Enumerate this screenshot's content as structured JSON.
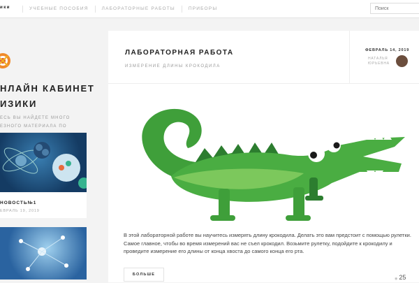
{
  "topbar": {
    "home": "ики",
    "nav": [
      "УЧЕБНЫЕ ПОСОБИЯ",
      "ЛАБОРАТОРНЫЕ РАБОТЫ",
      "ПРИБОРЫ"
    ],
    "search_placeholder": "Поиск"
  },
  "sidebar": {
    "title_line1": "НЛАЙН КАБИНЕТ",
    "title_line2": "ИЗИКИ",
    "desc_line1": "ЕСЬ ВЫ НАЙДЕТЕ МНОГО",
    "desc_line2": "ЕЗНОГО МАТЕРИАЛА ПО ФИЗИКЕ!",
    "cards": [
      {
        "title": "НОВОСТЬ№1",
        "date": "ЕВРАЛЬ 19, 2019"
      },
      {
        "title": "",
        "date": ""
      }
    ]
  },
  "post": {
    "title": "ЛАБОРАТОРНАЯ РАБОТА",
    "subtitle": "ИЗМЕРЕНИЕ ДЛИНЫ КРОКОДИЛА",
    "date": "ФЕВРАЛЬ 14, 2019",
    "author": "НАТАЛЬЯ ЮРЬЕВНА",
    "body": "В этой лабораторной работе вы научитесь измерять длину крокодила. Делать это вам предстоит с помощью рулетки. Самое главное, чтобы во время измерений вас не съел крокодил. Возьмите рулетку, подойдите к крокодилу и проведите измерение его длины от конца хвоста до самого конца его рта.",
    "more_label": "БОЛЬШЕ",
    "views": "25"
  }
}
